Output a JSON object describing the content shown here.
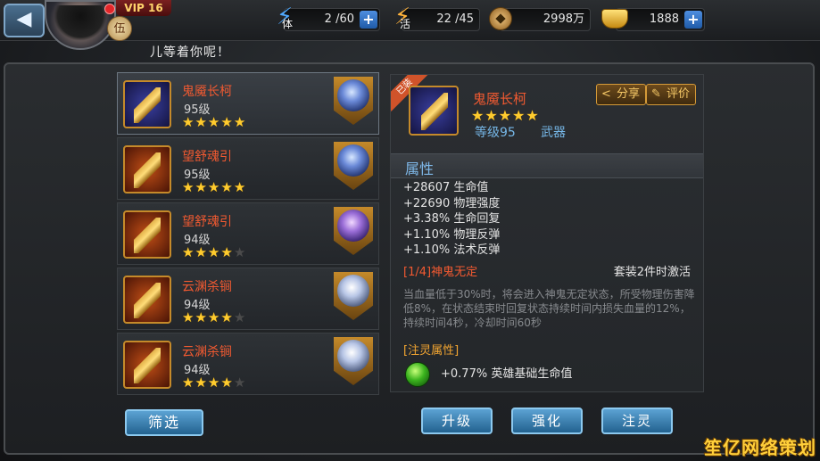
{
  "header": {
    "vip_label": "VIP 16",
    "rank_char": "伍",
    "marquee_text": "儿等着你呢！",
    "resources": [
      {
        "icon": "stamina-lightning-icon",
        "caption": "体",
        "value": "2 /60",
        "has_plus": true,
        "color": "#4ea9ff"
      },
      {
        "icon": "energy-lightning-icon",
        "caption": "活",
        "value": "22 /45",
        "has_plus": false,
        "color": "#ffb23a"
      },
      {
        "icon": "copper-coin-icon",
        "caption": "",
        "value": "2998万",
        "has_plus": false,
        "color": "#d9a45a"
      },
      {
        "icon": "gold-ingot-icon",
        "caption": "",
        "value": "1888",
        "has_plus": true,
        "color": "#ffd24a"
      }
    ]
  },
  "equipment_list": [
    {
      "name": "鬼魇长柯",
      "level": "95级",
      "stars": 5,
      "max_stars": 5,
      "thumb_color": "blue",
      "hero": "blue",
      "selected": true
    },
    {
      "name": "望舒魂引",
      "level": "95级",
      "stars": 5,
      "max_stars": 5,
      "thumb_color": "orange",
      "hero": "blue",
      "selected": false
    },
    {
      "name": "望舒魂引",
      "level": "94级",
      "stars": 4,
      "max_stars": 5,
      "thumb_color": "orange",
      "hero": "purple",
      "selected": false
    },
    {
      "name": "云渊杀锏",
      "level": "94级",
      "stars": 4,
      "max_stars": 5,
      "thumb_color": "orange",
      "hero": "pale",
      "selected": false
    },
    {
      "name": "云渊杀锏",
      "level": "94级",
      "stars": 4,
      "max_stars": 5,
      "thumb_color": "orange",
      "hero": "pale",
      "selected": false
    }
  ],
  "filter_label": "筛选",
  "detail": {
    "ribbon_text": "已装",
    "name": "鬼魇长柯",
    "stars": 5,
    "level": "等级95",
    "type": "武器",
    "share_label": "分享",
    "review_label": "评价",
    "attr_header": "属性",
    "attributes": [
      "+28607 生命值",
      "+22690 物理强度",
      "+3.38% 生命回复",
      "+1.10% 物理反弹",
      "+1.10% 法术反弹"
    ],
    "set_title": "[1/4]神鬼无定",
    "set_status": "套装2件时激活",
    "set_desc": "当血量低于30%时，将会进入神鬼无定状态，所受物理伤害降低8%，在状态结束时回复状态持续时间内损失血量的12%，持续时间4秒，冷却时间60秒",
    "spirit_title": "[注灵属性]",
    "spirit_value": "+0.77% 英雄基础生命值"
  },
  "actions": {
    "upgrade": "升级",
    "enhance": "强化",
    "infuse": "注灵"
  },
  "watermark": "笙亿网络策划"
}
